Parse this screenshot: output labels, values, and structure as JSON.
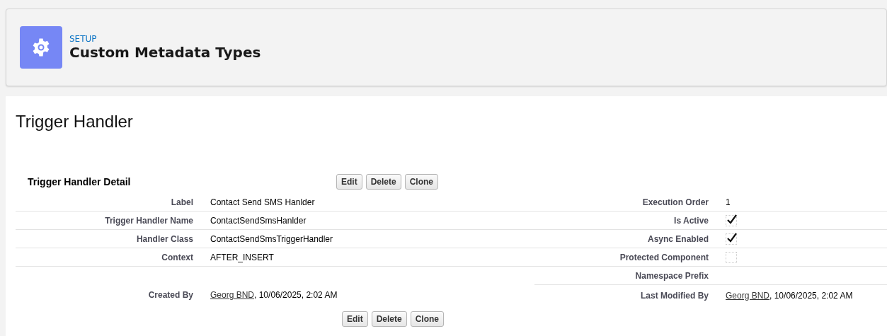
{
  "header": {
    "eyebrow": "SETUP",
    "title": "Custom Metadata Types"
  },
  "page_title": "Trigger Handler",
  "section": {
    "title": "Trigger Handler Detail",
    "buttons": [
      "Edit",
      "Delete",
      "Clone"
    ]
  },
  "rows": [
    {
      "left": {
        "label": "Label",
        "kind": "text",
        "value": "Contact Send SMS Hanlder"
      },
      "right": {
        "label": "Execution Order",
        "kind": "text",
        "value": "1"
      }
    },
    {
      "left": {
        "label": "Trigger Handler Name",
        "kind": "text",
        "value": "ContactSendSmsHanlder"
      },
      "right": {
        "label": "Is Active",
        "kind": "checkbox",
        "checked": true
      }
    },
    {
      "left": {
        "label": "Handler Class",
        "kind": "text",
        "value": "ContactSendSmsTriggerHandler"
      },
      "right": {
        "label": "Async Enabled",
        "kind": "checkbox",
        "checked": true
      }
    },
    {
      "left": {
        "label": "Context",
        "kind": "text",
        "value": "AFTER_INSERT"
      },
      "right": {
        "label": "Protected Component",
        "kind": "checkbox",
        "checked": false
      }
    },
    {
      "right": {
        "label": "Namespace Prefix",
        "kind": "empty"
      }
    },
    {
      "left": {
        "label": "Created By",
        "kind": "user",
        "user": "Georg BND",
        "value": ", 10/06/2025, 2:02 AM"
      },
      "right": {
        "label": "Last Modified By",
        "kind": "user",
        "user": "Georg BND",
        "value": ", 10/06/2025, 2:02 AM"
      }
    }
  ],
  "bottom_buttons": [
    "Edit",
    "Delete",
    "Clone"
  ]
}
